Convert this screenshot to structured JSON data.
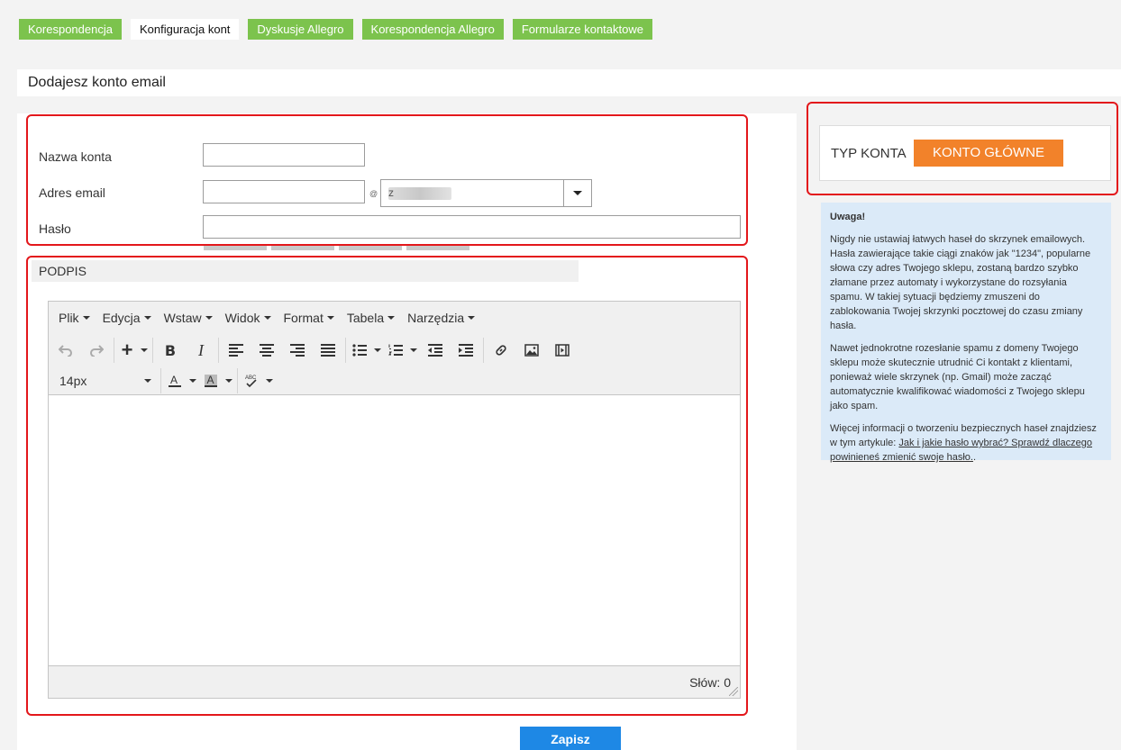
{
  "tabs": [
    {
      "label": "Korespondencja",
      "active": false
    },
    {
      "label": "Konfiguracja kont",
      "active": true
    },
    {
      "label": "Dyskusje Allegro",
      "active": false
    },
    {
      "label": "Korespondencja Allegro",
      "active": false
    },
    {
      "label": "Formularze kontaktowe",
      "active": false
    }
  ],
  "page_title": "Dodajesz konto email",
  "form": {
    "account_name_label": "Nazwa konta",
    "account_name_value": "",
    "email_label": "Adres email",
    "email_value": "",
    "at_sign": "@",
    "domain_value": "z",
    "password_label": "Hasło",
    "password_value": ""
  },
  "signature": {
    "section_label": "PODPIS",
    "menus": [
      "Plik",
      "Edycja",
      "Wstaw",
      "Widok",
      "Format",
      "Tabela",
      "Narzędzia"
    ],
    "font_size": "14px",
    "word_count": "Słów: 0"
  },
  "save_label": "Zapisz",
  "account_type": {
    "label": "TYP KONTA",
    "button": "KONTO GŁÓWNE"
  },
  "warning": {
    "heading": "Uwaga!",
    "p1": "Nigdy nie ustawiaj łatwych haseł do skrzynek emailowych. Hasła zawierające takie ciągi znaków jak \"1234\", popularne słowa czy adres Twojego sklepu, zostaną bardzo szybko złamane przez automaty i wykorzystane do rozsyłania spamu. W takiej sytuacji będziemy zmuszeni do zablokowania Twojej skrzynki pocztowej do czasu zmiany hasła.",
    "p2": "Nawet jednokrotne rozesłanie spamu z domeny Twojego sklepu może skutecznie utrudnić Ci kontakt z klientami, ponieważ wiele skrzynek (np. Gmail) może zacząć automatycznie kwalifikować wiadomości z Twojego sklepu jako spam.",
    "p3_prefix": "Więcej informacji o tworzeniu bezpiecznych haseł znajdziesz w tym artykule: ",
    "p3_link": "Jak i jakie hasło wybrać? Sprawdź dlaczego powinieneś zmienić swoje hasło.",
    "p3_suffix": "."
  },
  "colors": {
    "tab_green": "#7cc34d",
    "highlight_red": "#e3171b",
    "account_type_orange": "#f2822a",
    "save_blue": "#1e88e5",
    "info_blue": "#dbeaf8"
  }
}
